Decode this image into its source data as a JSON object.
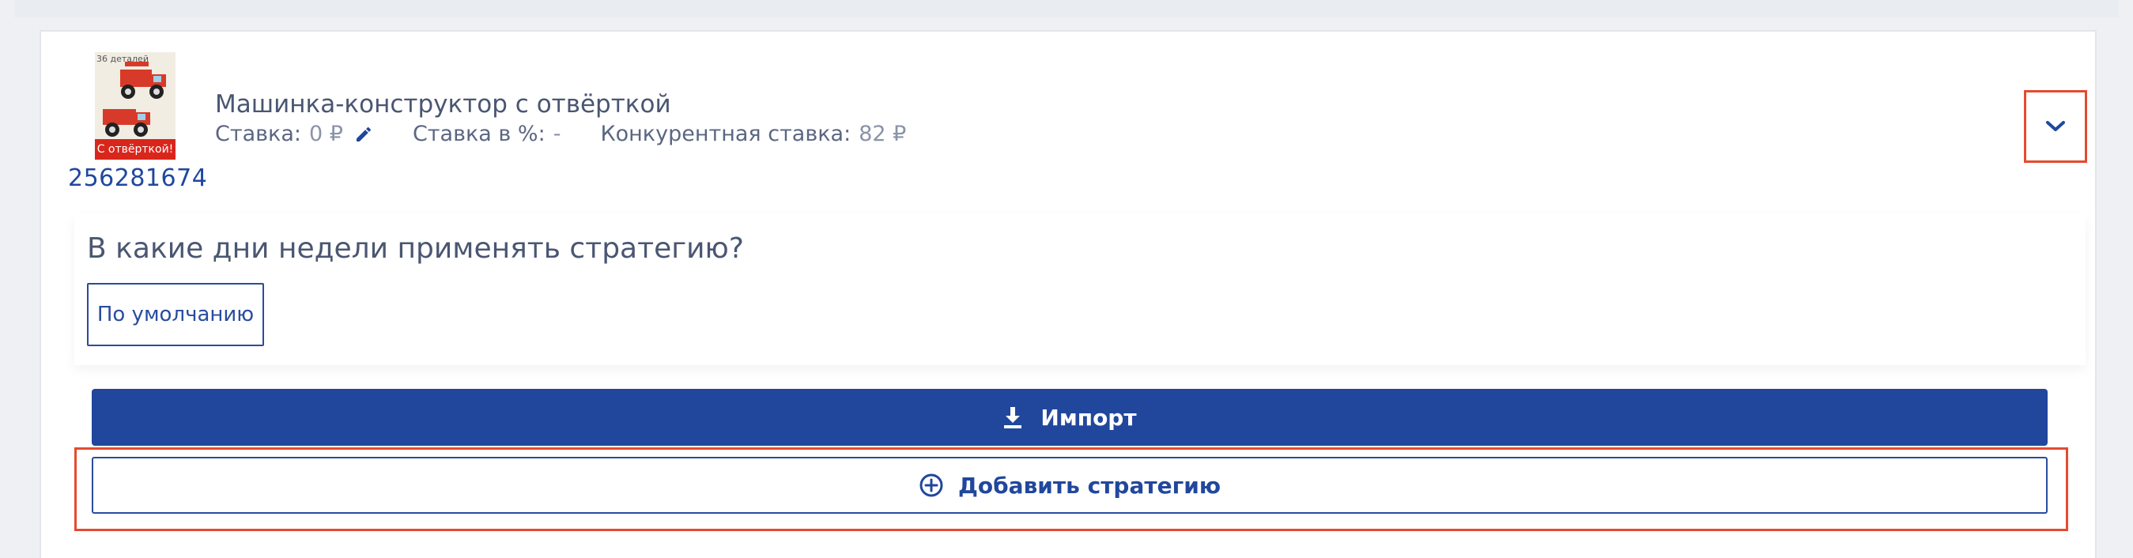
{
  "product": {
    "image_caption_top": "36 деталей",
    "image_ribbon": "С отвёрткой!",
    "sku": "256281674",
    "title": "Машинка-конструктор с отвёрткой",
    "bid_label": "Ставка:",
    "bid_value": "0 ₽",
    "bid_percent_label": "Ставка в %:",
    "bid_percent_value": "-",
    "competitor_label": "Конкурентная ставка:",
    "competitor_value": "82 ₽"
  },
  "strategy": {
    "question": "В какие дни недели применять стратегию?",
    "default_button": "По умолчанию",
    "import_button": "Импорт",
    "add_button": "Добавить стратегию"
  },
  "icons": {
    "expand": "chevron-down-icon",
    "edit": "pencil-icon",
    "import": "download-icon",
    "add": "plus-circle-icon"
  },
  "colors": {
    "primary": "#21479d",
    "highlight": "#e44b2f",
    "text": "#4a5672"
  }
}
